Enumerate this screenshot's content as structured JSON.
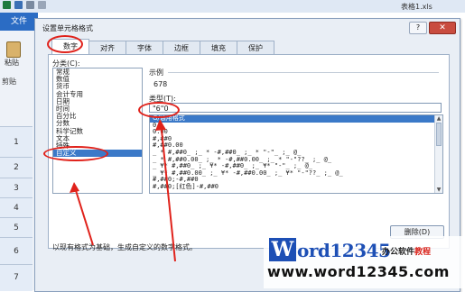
{
  "excel": {
    "file_tab": "文件",
    "window_title": "表格1.xls",
    "paste_label": "粘贴",
    "clipboard_label": "剪贴",
    "row_numbers": [
      "1",
      "2",
      "3",
      "4",
      "5",
      "6",
      "7"
    ],
    "window_controls": [
      "—",
      "□",
      "✕"
    ]
  },
  "dialog": {
    "title": "设置单元格格式",
    "help_label": "?",
    "close_label": "✕",
    "tabs": [
      "数字",
      "对齐",
      "字体",
      "边框",
      "填充",
      "保护"
    ],
    "active_tab": "数字",
    "category_label": "分类(C):",
    "categories": [
      "常规",
      "数值",
      "货币",
      "会计专用",
      "日期",
      "时间",
      "百分比",
      "分数",
      "科学记数",
      "文本",
      "特殊",
      "自定义"
    ],
    "selected_category": "自定义",
    "sample_label": "示例",
    "sample_value": "678",
    "type_label": "类型(T):",
    "type_value": "\"6\"0",
    "format_codes": [
      "G/通用格式",
      "0",
      "0.00",
      "#,##0",
      "#,##0.00",
      "_ * #,##0_ ;_ * -#,##0_ ;_ * \"-\"_ ;_ @_",
      "_ * #,##0.00_ ;_ * -#,##0.00_ ;_ * \"-\"??_ ;_ @_",
      "_ ¥* #,##0_ ;_ ¥* -#,##0_ ;_ ¥* \"-\"_ ;_ @_",
      "_ ¥* #,##0.00_ ;_ ¥* -#,##0.00_ ;_ ¥* \"-\"??_ ;_ @_",
      "#,##0;-#,##0",
      "#,##0;[红色]-#,##0"
    ],
    "selected_format": "G/通用格式",
    "delete_button": "删除(D)",
    "description": "以现有格式为基础，生成自定义的数字格式。"
  },
  "watermark": {
    "logo_letter": "W",
    "logo_text": "ord12345",
    "tagline_a": "办公软件",
    "tagline_b": "教程",
    "url": "www.word12345.com"
  },
  "colors": {
    "accent": "#e0221b",
    "selection": "#3b79c8",
    "brand": "#1d4fb5"
  }
}
